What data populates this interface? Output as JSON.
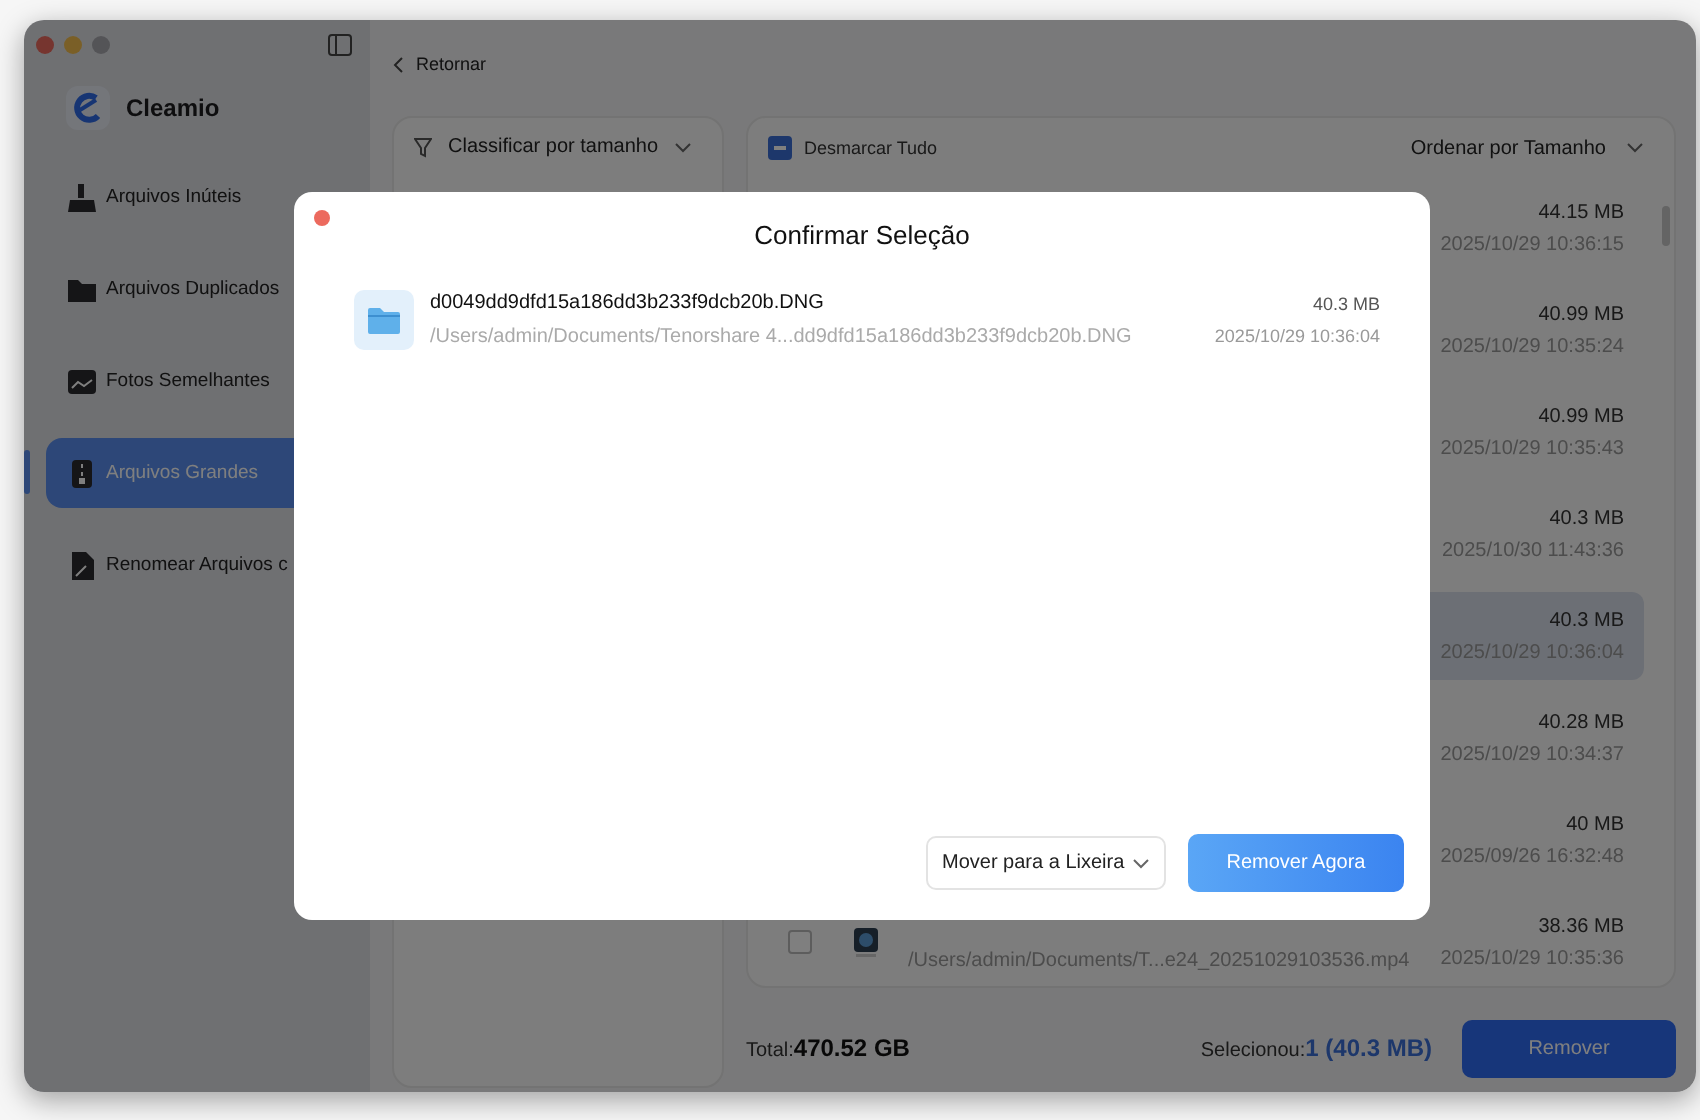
{
  "app": {
    "name": "Cleamio"
  },
  "sidebar": {
    "items": [
      {
        "label": "Arquivos Inúteis",
        "selected": false
      },
      {
        "label": "Arquivos Duplicados",
        "selected": false
      },
      {
        "label": "Fotos Semelhantes",
        "selected": false
      },
      {
        "label": "Arquivos Grandes",
        "selected": true
      },
      {
        "label": "Renomear Arquivos c",
        "selected": false
      }
    ]
  },
  "back_link": "Retornar",
  "filter": {
    "label": "Classificar por tamanho"
  },
  "list": {
    "select_all": {
      "label": "Desmarcar Tudo",
      "indeterminate": true
    },
    "sort": "Ordenar por Tamanho",
    "rows": [
      {
        "kind": "covered",
        "size": "44.15  MB",
        "date": "2025/10/29 10:36:15",
        "selected": false
      },
      {
        "kind": "covered",
        "size": "40.99  MB",
        "date": "2025/10/29 10:35:24",
        "selected": false
      },
      {
        "kind": "covered",
        "size": "40.99  MB",
        "date": "2025/10/29 10:35:43",
        "selected": false
      },
      {
        "kind": "covered",
        "size": "40.3  MB",
        "date": "2025/10/30 11:43:36",
        "selected": false
      },
      {
        "kind": "covered",
        "size": "40.3  MB",
        "date": "2025/10/29 10:36:04",
        "selected": true
      },
      {
        "kind": "covered",
        "size": "40.28  MB",
        "date": "2025/10/29 10:34:37",
        "selected": false
      },
      {
        "kind": "covered",
        "size": "40  MB",
        "date": "2025/09/26 16:32:48",
        "selected": false
      },
      {
        "kind": "full",
        "checked": false,
        "path": "/Users/admin/Documents/T...e24_20251029103536.mp4",
        "size": "38.36  MB",
        "date": "2025/10/29 10:35:36",
        "selected": false
      }
    ]
  },
  "footer": {
    "total_label": "Total:",
    "total": "470.52 GB",
    "selected_label": "Selecionou:",
    "selected": "1 (40.3  MB)",
    "button": "Remover"
  },
  "dialog": {
    "title": "Confirmar Seleção",
    "items": [
      {
        "name": "d0049dd9dfd15a186dd3b233f9dcb20b.DNG",
        "path": "/Users/admin/Documents/Tenorshare 4...dd9dfd15a186dd3b233f9dcb20b.DNG",
        "size": "40.3  MB",
        "date": "2025/10/29 10:36:04"
      }
    ],
    "action": {
      "value": "Mover para a Lixeira"
    },
    "confirm": "Remover Agora"
  }
}
